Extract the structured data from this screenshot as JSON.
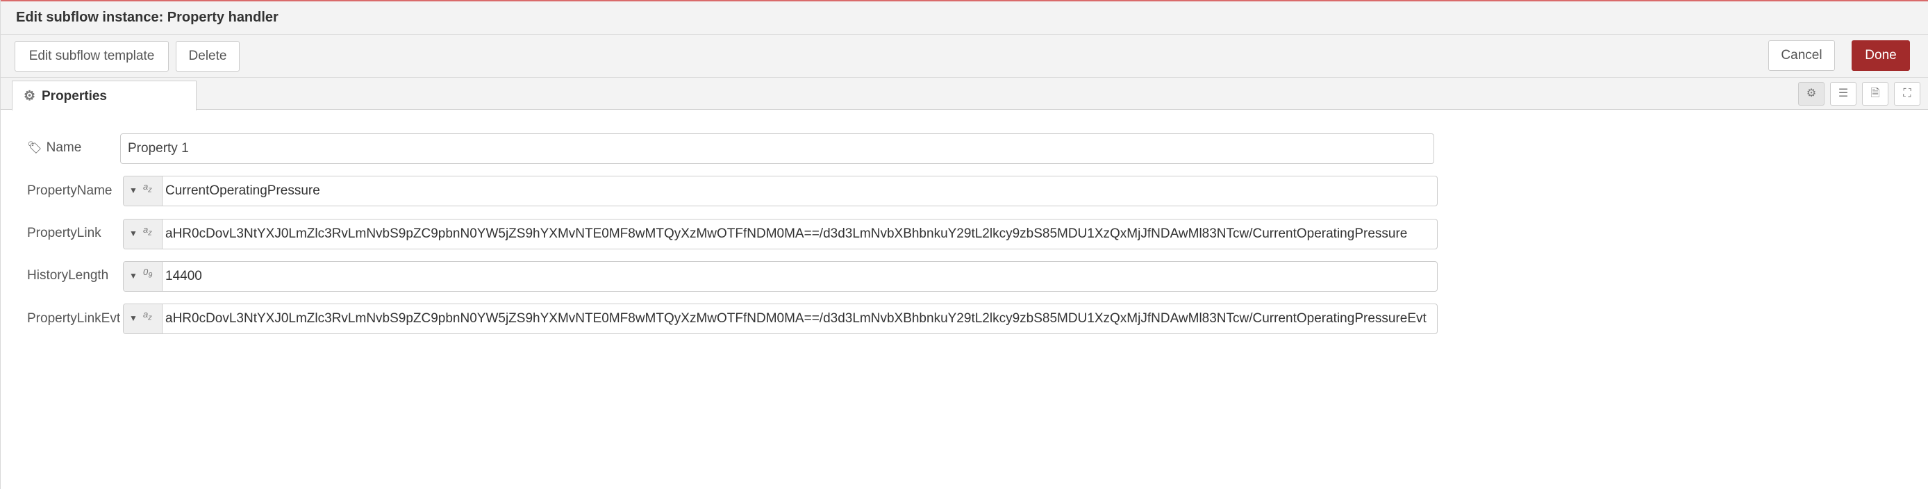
{
  "header": {
    "title": "Edit subflow instance: Property handler"
  },
  "toolbar": {
    "edit_template_label": "Edit subflow template",
    "delete_label": "Delete",
    "cancel_label": "Cancel",
    "done_label": "Done"
  },
  "tabs": [
    {
      "label": "Properties",
      "icon": "gear-icon"
    }
  ],
  "side_icons": [
    "gear-icon",
    "list-icon",
    "document-icon",
    "resize-icon"
  ],
  "form": {
    "name": {
      "label": "Name",
      "icon": "tag-icon",
      "value": "Property 1"
    },
    "fields": [
      {
        "label": "PropertyName",
        "type": "string",
        "value": "CurrentOperatingPressure"
      },
      {
        "label": "PropertyLink",
        "type": "string",
        "value": "aHR0cDovL3NtYXJ0LmZlc3RvLmNvbS9pZC9pbnN0YW5jZS9hYXMvNTE0MF8wMTQyXzMwOTFfNDM0MA==/d3d3LmNvbXBhbnkuY29tL2lkcy9zbS85MDU1XzQxMjJfNDAwMl83NTcw/CurrentOperatingPressure"
      },
      {
        "label": "HistoryLength",
        "type": "number",
        "value": "14400"
      },
      {
        "label": "PropertyLinkEvt",
        "type": "string",
        "value": "aHR0cDovL3NtYXJ0LmZlc3RvLmNvbS9pZC9pbnN0YW5jZS9hYXMvNTE0MF8wMTQyXzMwOTFfNDM0MA==/d3d3LmNvbXBhbnkuY29tL2lkcy9zbS85MDU1XzQxMjJfNDAwMl83NTcw/CurrentOperatingPressureEvt"
      }
    ]
  },
  "colors": {
    "primary": "#a22b2b",
    "border": "#cccccc",
    "tray_bg": "#f3f3f3"
  }
}
